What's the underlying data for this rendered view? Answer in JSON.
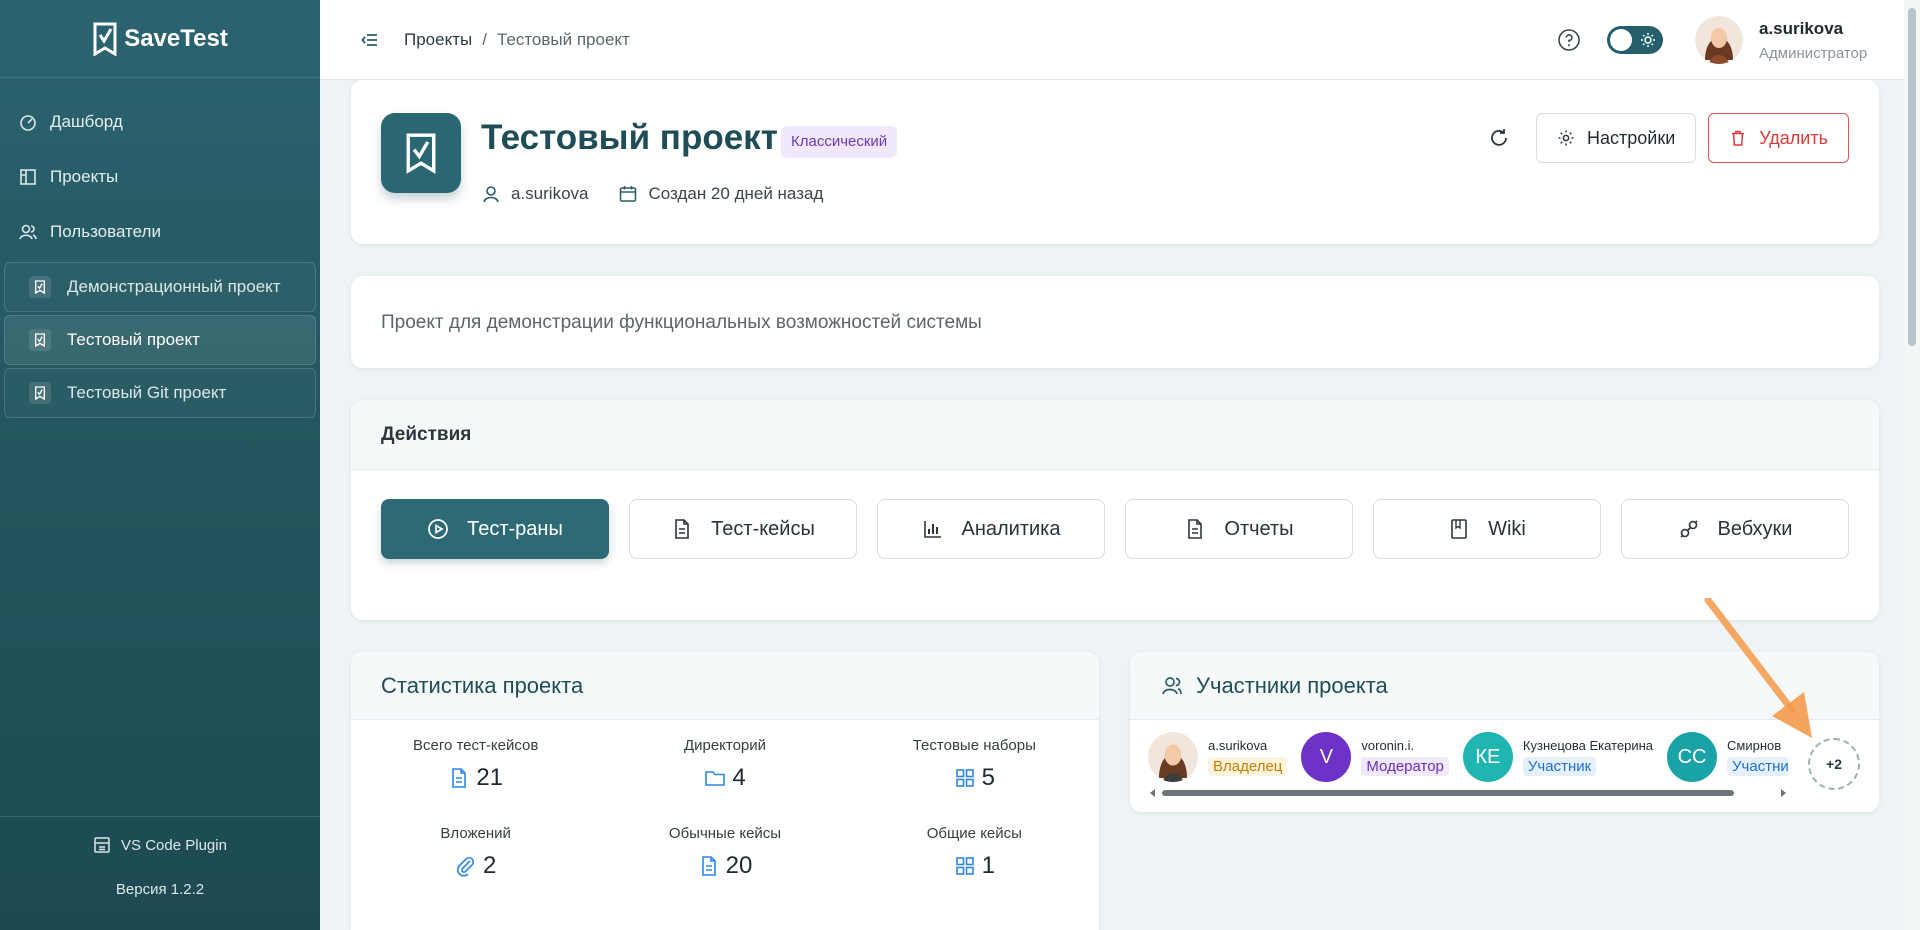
{
  "app": {
    "name": "SaveTest"
  },
  "sidebar": {
    "nav": [
      {
        "label": "Дашборд",
        "icon": "dashboard-icon"
      },
      {
        "label": "Проекты",
        "icon": "projects-icon"
      },
      {
        "label": "Пользователи",
        "icon": "users-icon"
      }
    ],
    "projects": [
      {
        "label": "Демонстрационный проект",
        "active": false
      },
      {
        "label": "Тестовый проект",
        "active": true
      },
      {
        "label": "Тестовый Git проект",
        "active": false
      }
    ],
    "plugin_label": "VS Code Plugin",
    "version": "Версия 1.2.2"
  },
  "header": {
    "breadcrumb": {
      "root": "Проекты",
      "sep": "/",
      "current": "Тестовый проект"
    },
    "user": {
      "name": "a.surikova",
      "role": "Администратор"
    }
  },
  "project": {
    "title": "Тестовый проект",
    "badge": "Классический",
    "owner": "a.surikova",
    "created": "Создан 20 дней назад",
    "settings_label": "Настройки",
    "delete_label": "Удалить",
    "description": "Проект для демонстрации функциональных возможностей системы"
  },
  "actions": {
    "title": "Действия",
    "buttons": [
      {
        "label": "Тест-раны",
        "icon": "play-circle-icon",
        "primary": true
      },
      {
        "label": "Тест-кейсы",
        "icon": "document-icon",
        "primary": false
      },
      {
        "label": "Аналитика",
        "icon": "bar-chart-icon",
        "primary": false
      },
      {
        "label": "Отчеты",
        "icon": "report-icon",
        "primary": false
      },
      {
        "label": "Wiki",
        "icon": "book-icon",
        "primary": false
      },
      {
        "label": "Вебхуки",
        "icon": "webhook-icon",
        "primary": false
      }
    ]
  },
  "stats": {
    "title": "Статистика проекта",
    "items": [
      {
        "label": "Всего тест-кейсов",
        "value": "21",
        "icon": "document-icon"
      },
      {
        "label": "Директорий",
        "value": "4",
        "icon": "folder-icon"
      },
      {
        "label": "Тестовые наборы",
        "value": "5",
        "icon": "grid-icon"
      },
      {
        "label": "Вложений",
        "value": "2",
        "icon": "paperclip-icon"
      },
      {
        "label": "Обычные кейсы",
        "value": "20",
        "icon": "document-icon"
      },
      {
        "label": "Общие кейсы",
        "value": "1",
        "icon": "grid-icon"
      }
    ]
  },
  "members": {
    "title": "Участники проекта",
    "list": [
      {
        "name": "a.surikova",
        "role": "Владелец",
        "initials": "",
        "color": "#f3d9c6",
        "role_class": "role-owner"
      },
      {
        "name": "voronin.i.",
        "role": "Модератор",
        "initials": "V",
        "color": "#6d32c7",
        "role_class": "role-mod"
      },
      {
        "name": "Кузнецова Екатерина",
        "role": "Участник",
        "initials": "КЕ",
        "color": "#1fb5b0",
        "role_class": "role-part"
      },
      {
        "name": "Смирнов",
        "role": "Участник",
        "initials": "СС",
        "color": "#1aa3a6",
        "role_class": "role-part"
      }
    ],
    "more": "+2"
  },
  "colors": {
    "primary": "#2d6a76",
    "danger": "#dc3a3a",
    "accent_arrow": "#f49a4a"
  }
}
